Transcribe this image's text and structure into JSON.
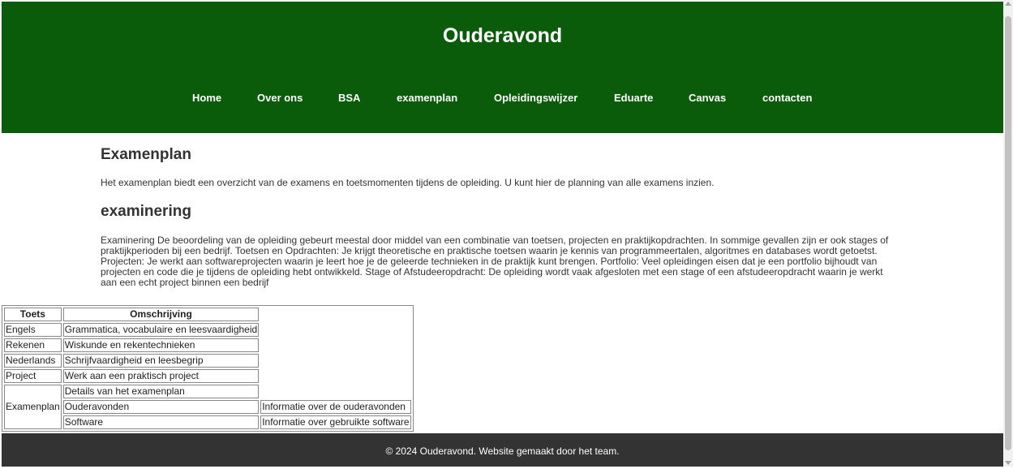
{
  "header": {
    "title": "Ouderavond",
    "nav": [
      "Home",
      "Over ons",
      "BSA",
      "examenplan",
      "Opleidingswijzer",
      "Eduarte",
      "Canvas",
      "contacten"
    ]
  },
  "main": {
    "heading1": "Examenplan",
    "paragraph1": "Het examenplan biedt een overzicht van de examens en toetsmomenten tijdens de opleiding. U kunt hier de planning van alle examens inzien.",
    "heading2": "examinering",
    "paragraph2": "Examinering De beoordeling van de opleiding gebeurt meestal door middel van een combinatie van toetsen, projecten en praktijkopdrachten. In sommige gevallen zijn er ook stages of praktijkperioden bij een bedrijf. Toetsen en Opdrachten: Je krijgt theoretische en praktische toetsen waarin je kennis van programmeertalen, algoritmes en databases wordt getoetst. Projecten: Je werkt aan softwareprojecten waarin je leert hoe je de geleerde technieken in de praktijk kunt brengen. Portfolio: Veel opleidingen eisen dat je een portfolio bijhoudt van projecten en code die je tijdens de opleiding hebt ontwikkeld. Stage of Afstudeeropdracht: De opleiding wordt vaak afgesloten met een stage of een afstudeeropdracht waarin je werkt aan een echt project binnen een bedrijf"
  },
  "table": {
    "headers": [
      "Toets",
      "Omschrijving"
    ],
    "rows": [
      [
        "Engels",
        "Grammatica, vocabulaire en leesvaardigheid"
      ],
      [
        "Rekenen",
        "Wiskunde en rekentechnieken"
      ],
      [
        "Nederlands",
        "Schrijfvaardigheid en leesbegrip"
      ],
      [
        "Project",
        "Werk aan een praktisch project"
      ]
    ],
    "examenplan_label": "Examenplan",
    "examenplan_rows": [
      [
        "Details van het examenplan",
        ""
      ],
      [
        "Ouderavonden",
        "Informatie over de ouderavonden"
      ],
      [
        "Software",
        "Informatie over gebruikte software"
      ]
    ]
  },
  "footer": {
    "text": "© 2024 Ouderavond. Website gemaakt door het team."
  },
  "colors": {
    "header_bg": "#0a5c0a",
    "footer_bg": "#333333"
  }
}
